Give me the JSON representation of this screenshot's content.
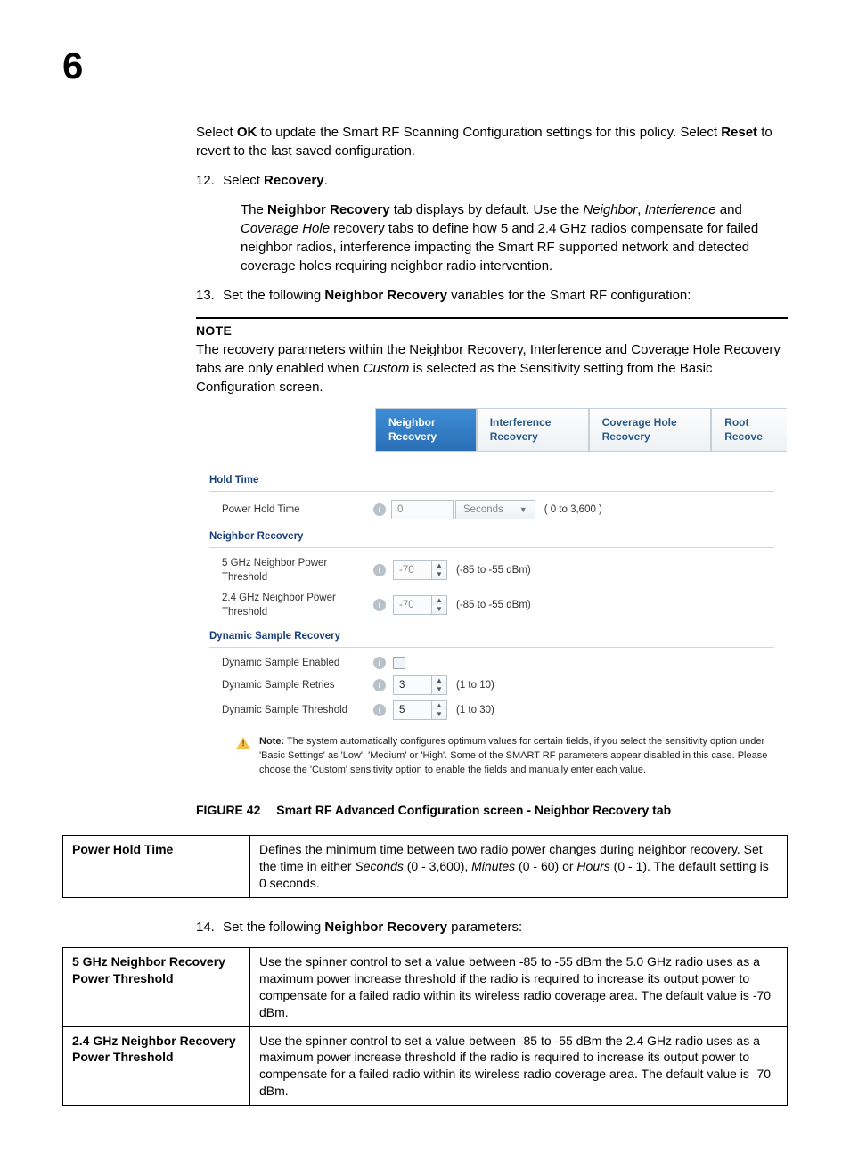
{
  "chapter_number": "6",
  "intro": {
    "p1_a": "Select ",
    "ok": "OK",
    "p1_b": " to update the Smart RF Scanning Configuration settings for this policy. Select ",
    "reset": "Reset",
    "p1_c": " to revert to the last saved configuration."
  },
  "step12": {
    "num": "12.",
    "text_a": "Select ",
    "bold": "Recovery",
    "text_b": "."
  },
  "step12_sub": {
    "a": "The ",
    "b": "Neighbor Recovery",
    "c": " tab displays by default. Use the ",
    "d": "Neighbor",
    "e": ", ",
    "f": "Interference",
    "g": " and ",
    "h": "Coverage Hole",
    "i": " recovery tabs to define how 5 and 2.4 GHz radios compensate for failed neighbor radios, interference impacting the Smart RF supported network and detected coverage holes requiring neighbor radio intervention."
  },
  "step13": {
    "num": "13.",
    "a": "Set the following ",
    "b": "Neighbor Recovery",
    "c": " variables for the Smart RF configuration:"
  },
  "note": {
    "head": "NOTE",
    "body_a": "The recovery parameters within the Neighbor Recovery, Interference and Coverage Hole Recovery tabs are only enabled when ",
    "body_i": "Custom",
    "body_b": " is selected as the Sensitivity setting from the Basic Configuration screen."
  },
  "tabs": {
    "t1": "Neighbor Recovery",
    "t2": "Interference Recovery",
    "t3": "Coverage Hole Recovery",
    "t4": "Root Recove"
  },
  "fig": {
    "grp_hold": "Hold Time",
    "power_hold_label": "Power Hold Time",
    "power_hold_value": "0",
    "power_hold_unit": "Seconds",
    "power_hold_range": "( 0 to 3,600 )",
    "grp_nr": "Neighbor Recovery",
    "nr5_label": "5 GHz Neighbor Power Threshold",
    "nr5_value": "-70",
    "nr5_range": "(-85 to -55 dBm)",
    "nr24_label": "2.4 GHz Neighbor Power Threshold",
    "nr24_value": "-70",
    "nr24_range": "(-85 to -55 dBm)",
    "grp_dsr": "Dynamic Sample Recovery",
    "dse_label": "Dynamic Sample Enabled",
    "dsr_label": "Dynamic Sample Retries",
    "dsr_value": "3",
    "dsr_range": "(1 to 10)",
    "dst_label": "Dynamic Sample Threshold",
    "dst_value": "5",
    "dst_range": "(1 to 30)",
    "note_bold": "Note:",
    "note_text": " The system automatically configures optimum values for certain fields, if you select the sensitivity option under 'Basic Settings' as 'Low', 'Medium' or 'High'. Some of the SMART RF parameters appear disabled in this case. Please choose the 'Custom' sensitivity option to enable the fields and manually enter each value."
  },
  "caption": {
    "lead": "FIGURE 42",
    "text": "Smart RF Advanced Configuration screen - Neighbor Recovery tab"
  },
  "table1": {
    "h": "Power Hold Time",
    "d_a": "Defines the minimum time between two radio power changes during neighbor recovery. Set the time in either ",
    "d_i1": "Seconds",
    "d_b": " (0 - 3,600), ",
    "d_i2": "Minutes",
    "d_c": " (0 - 60) or ",
    "d_i3": "Hours",
    "d_d": " (0 - 1). The default setting is 0 seconds."
  },
  "step14": {
    "num": "14.",
    "a": "Set the following ",
    "b": "Neighbor Recovery",
    "c": " parameters:"
  },
  "table2": {
    "r1h": "5 GHz Neighbor Recovery Power Threshold",
    "r1d": "Use the spinner control to set a value between -85 to -55 dBm the 5.0 GHz radio uses as a maximum power increase threshold if the radio is required to increase its output power to compensate for a failed radio within its wireless radio coverage area. The default value is -70 dBm.",
    "r2h": "2.4 GHz Neighbor Recovery Power Threshold",
    "r2d": "Use the spinner control to set a value between -85 to -55 dBm the 2.4 GHz radio uses as a maximum power increase threshold if the radio is required to increase its output power to compensate for a failed radio within its wireless radio coverage area. The default value is -70 dBm."
  }
}
